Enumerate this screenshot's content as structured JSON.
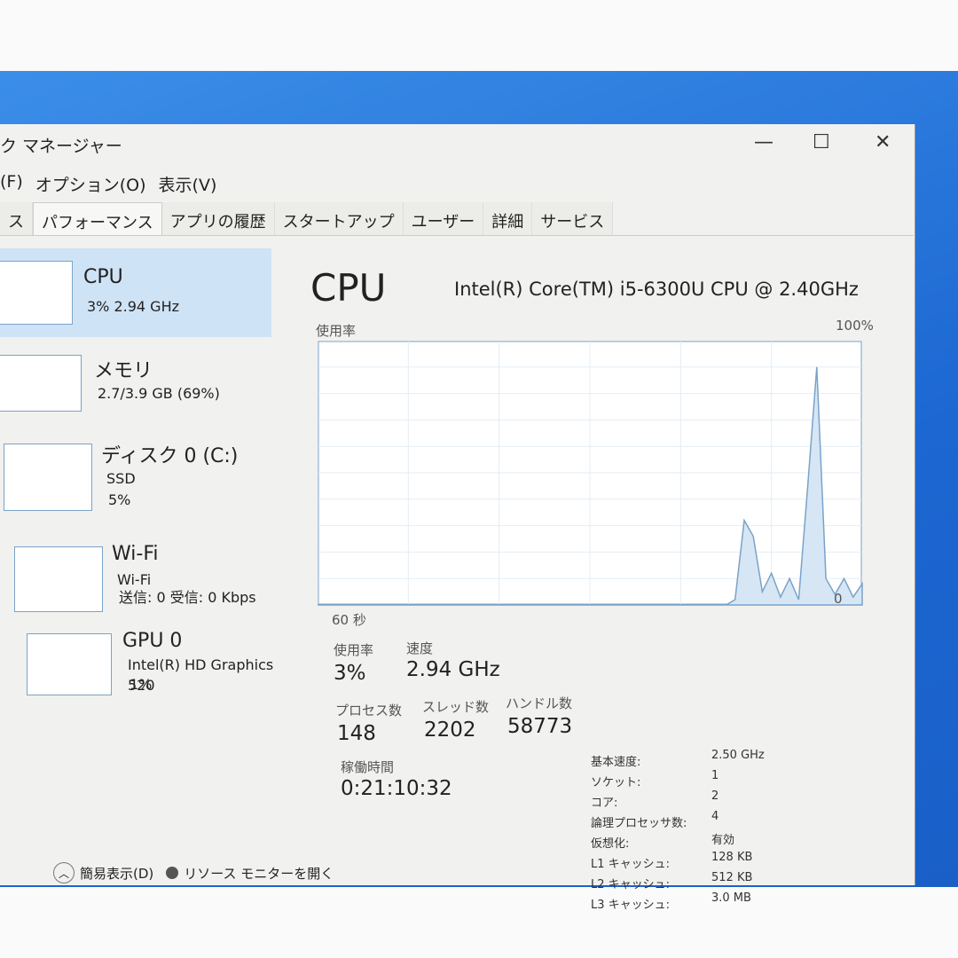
{
  "window": {
    "title": "ク マネージャー",
    "minimize": "—",
    "maximize": "☐",
    "close": "✕"
  },
  "menu": [
    "(F)",
    "オプション(O)",
    "表示(V)"
  ],
  "tabs": [
    "ス",
    "パフォーマンス",
    "アプリの履歴",
    "スタートアップ",
    "ユーザー",
    "詳細",
    "サービス"
  ],
  "active_tab": "パフォーマンス",
  "sidebar": [
    {
      "name": "CPU",
      "line1": "3% 2.94 GHz"
    },
    {
      "name": "メモリ",
      "line1": "2.7/3.9 GB (69%)"
    },
    {
      "name": "ディスク 0 (C:)",
      "line1": "SSD",
      "line2": "5%"
    },
    {
      "name": "Wi-Fi",
      "line1": "Wi-Fi",
      "line2": "送信: 0 受信: 0 Kbps"
    },
    {
      "name": "GPU 0",
      "line1": "Intel(R) HD Graphics 520",
      "line2": "1%"
    }
  ],
  "main": {
    "title": "CPU",
    "cpu_model": "Intel(R) Core(TM) i5-6300U CPU @ 2.40GHz",
    "graph_label": "使用率",
    "graph_max": "100%",
    "graph_time": "60 秒",
    "graph_min": "0",
    "usage_label": "使用率",
    "usage": "3%",
    "speed_label": "速度",
    "speed": "2.94 GHz",
    "proc_label": "プロセス数",
    "proc": "148",
    "thread_label": "スレッド数",
    "thread": "2202",
    "handle_label": "ハンドル数",
    "handle": "58773",
    "uptime_label": "稼働時間",
    "uptime": "0:21:10:32",
    "specs": [
      [
        "基本速度:",
        "2.50 GHz"
      ],
      [
        "ソケット:",
        "1"
      ],
      [
        "コア:",
        "2"
      ],
      [
        "論理プロセッサ数:",
        "4"
      ],
      [
        "仮想化:",
        "有効"
      ],
      [
        "L1 キャッシュ:",
        "128 KB"
      ],
      [
        "L2 キャッシュ:",
        "512 KB"
      ],
      [
        "L3 キャッシュ:",
        "3.0 MB"
      ]
    ]
  },
  "footer": {
    "simple": "簡易表示(D)",
    "monitor": "リソース モニターを開く"
  },
  "colors": {
    "graph_line": "#7aa3c9",
    "graph_fill": "#d6e6f4",
    "selected": "#cfe3f6"
  },
  "chart_data": {
    "type": "area",
    "ylim": [
      0,
      100
    ],
    "xlim_seconds": [
      60,
      0
    ],
    "values": [
      0,
      0,
      0,
      0,
      0,
      0,
      0,
      0,
      0,
      0,
      0,
      0,
      0,
      0,
      0,
      0,
      0,
      0,
      0,
      0,
      0,
      0,
      0,
      0,
      0,
      0,
      0,
      0,
      0,
      0,
      0,
      0,
      0,
      0,
      0,
      0,
      0,
      0,
      0,
      0,
      0,
      0,
      0,
      0,
      0,
      0,
      2,
      32,
      26,
      5,
      12,
      3,
      10,
      2,
      45,
      90,
      10,
      4,
      10,
      3,
      8
    ]
  }
}
